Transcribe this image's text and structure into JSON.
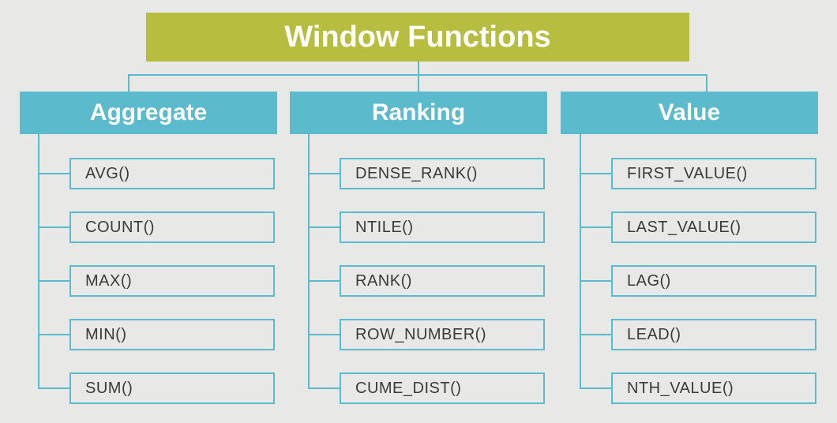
{
  "root": {
    "title": "Window Functions"
  },
  "categories": [
    {
      "label": "Aggregate",
      "items": [
        "AVG()",
        "COUNT()",
        "MAX()",
        "MIN()",
        "SUM()"
      ]
    },
    {
      "label": "Ranking",
      "items": [
        "DENSE_RANK()",
        "NTILE()",
        "RANK()",
        "ROW_NUMBER()",
        "CUME_DIST()"
      ]
    },
    {
      "label": "Value",
      "items": [
        "FIRST_VALUE()",
        "LAST_VALUE()",
        "LAG()",
        "LEAD()",
        "NTH_VALUE()"
      ]
    }
  ],
  "colors": {
    "root_bg": "#b7bd3f",
    "category_bg": "#5cbacd",
    "page_bg": "#e8e8e6",
    "item_text": "#3a3a3a"
  }
}
